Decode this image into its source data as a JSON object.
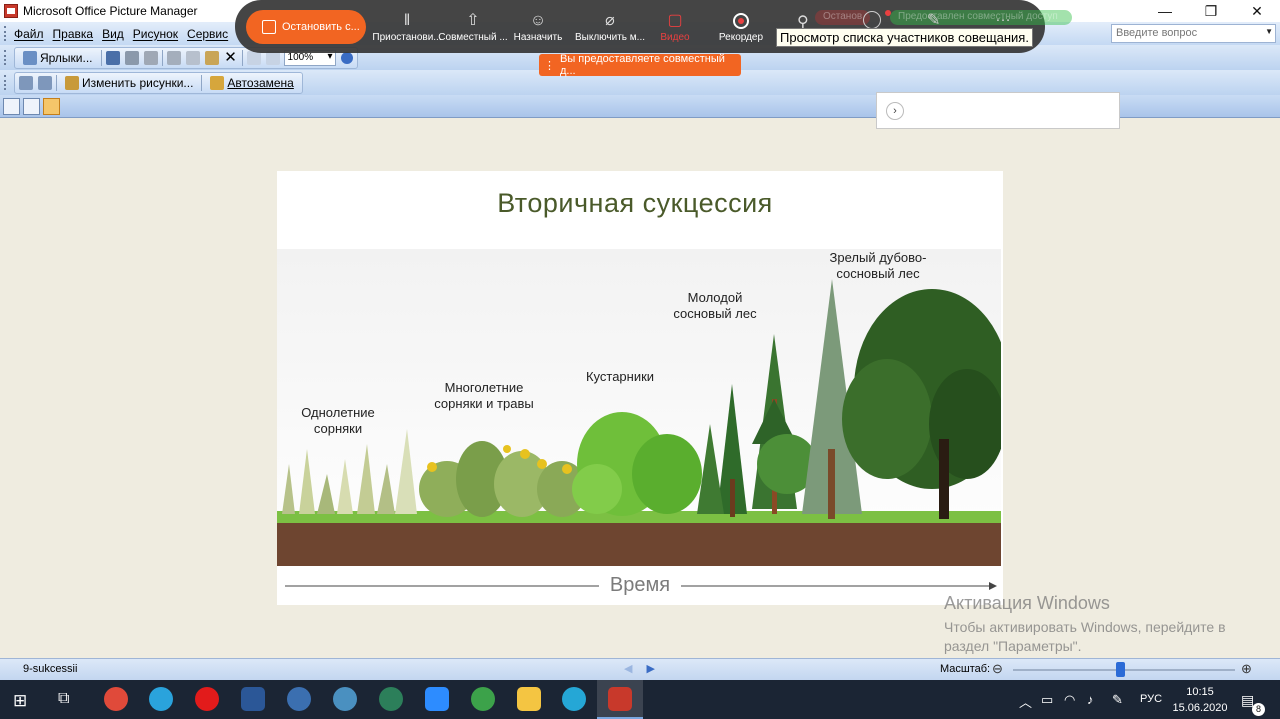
{
  "window": {
    "title": "Microsoft Office Picture Manager",
    "minimize": "—",
    "restore": "❐",
    "close": "✕"
  },
  "menu": {
    "items": [
      "Файл",
      "Правка",
      "Вид",
      "Рисунок",
      "Сервис"
    ],
    "ask_placeholder": "Введите вопрос"
  },
  "toolbar1": {
    "shortcuts_label": "Ярлыки...",
    "zoom_value": "100%"
  },
  "toolbar2": {
    "edit_pictures_label": "Изменить рисунки...",
    "autofix_label": "Автозамена"
  },
  "meeting": {
    "stop_share_label": "Остановить с...",
    "tools": [
      {
        "label": "Приостанови...",
        "icon": "pause-icon"
      },
      {
        "label": "Совместный ...",
        "icon": "share-icon"
      },
      {
        "label": "Назначить",
        "icon": "assign-icon"
      },
      {
        "label": "Выключить м...",
        "icon": "mic-off-icon"
      },
      {
        "label": "Видео",
        "icon": "video-off-icon"
      },
      {
        "label": "Рекордер",
        "icon": "record-icon"
      }
    ],
    "badge_stop": "Останов",
    "badge_shared": "Предоставлен совместный доступ",
    "tooltip": "Просмотр списка участников совещания.",
    "share_banner": "Вы предоставляете совместный д..."
  },
  "picture": {
    "title": "Вторичная  сукцессия",
    "stages": [
      {
        "line1": "Однолетние",
        "line2": "сорняки"
      },
      {
        "line1": "Многолетние",
        "line2": "сорняки и травы"
      },
      {
        "line1": "Кустарники",
        "line2": ""
      },
      {
        "line1": "Молодой",
        "line2": "сосновый лес"
      },
      {
        "line1": "Зрелый дубово-",
        "line2": "сосновый лес"
      }
    ],
    "time_label": "Время"
  },
  "activation": {
    "title": "Активация Windows",
    "line1": "Чтобы активировать Windows, перейдите в",
    "line2": "раздел \"Параметры\"."
  },
  "status": {
    "filename": "9-sukcessii",
    "scale_label": "Масштаб:",
    "zoom_fraction": 0.48
  },
  "taskbar": {
    "lang": "РУС",
    "time": "10:15",
    "date": "15.06.2020",
    "notif_count": "8",
    "colors": {
      "bg": "#1b2534",
      "chrome": "#e04a3a",
      "telegram": "#2aa3dc",
      "yandex": "#e21b1b",
      "word": "#2b5797",
      "zoom": "#2d8cff",
      "explorer": "#f4c542"
    }
  }
}
